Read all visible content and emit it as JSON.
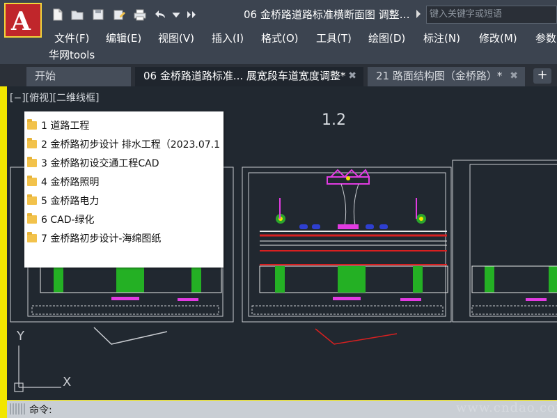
{
  "titlebar": {
    "title": "06 金桥路道路标准横断面图  调整…",
    "search_placeholder": "键入关键字或短语",
    "logo_letter": "A",
    "qa_icons": [
      "new-icon",
      "open-icon",
      "save-icon",
      "save-as-icon",
      "print-icon",
      "undo-icon",
      "dropdown-icon",
      "more-icon"
    ]
  },
  "menu": {
    "items": [
      "文件(F)",
      "编辑(E)",
      "视图(V)",
      "插入(I)",
      "格式(O)",
      "工具(T)",
      "绘图(D)",
      "标注(N)",
      "修改(M)",
      "参数"
    ],
    "plugin": "华网tools"
  },
  "tabs": [
    {
      "label": "开始",
      "active": false
    },
    {
      "label": "06 金桥路道路标准... 展宽段车道宽度调整*",
      "active": true
    },
    {
      "label": "21 路面结构图（金桥路）*",
      "active": false
    }
  ],
  "canvas": {
    "view_label": "[−][俯视][二维线框]",
    "scale_label": "1.2",
    "axis_y": "Y",
    "axis_x": "X"
  },
  "files": [
    "1 道路工程",
    "2 金桥路初步设计 排水工程（2023.07.1",
    "3 金桥路初设交通工程CAD",
    "4 金桥路照明",
    "5 金桥路电力",
    "6 CAD-绿化",
    "7 金桥路初步设计-海绵图纸"
  ],
  "command": {
    "prompt": "命令:"
  },
  "watermark": "www.cndao.com",
  "colors": {
    "frame": "#f2e600",
    "chrome": "#3c4450",
    "canvas": "#212830",
    "accent_red": "#c0262b"
  }
}
